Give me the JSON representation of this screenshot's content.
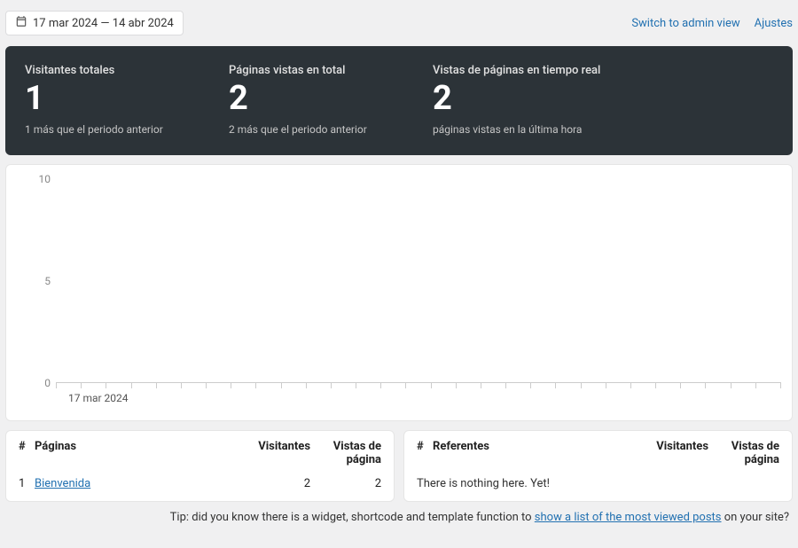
{
  "topbar": {
    "date_range": "17 mar 2024 — 14 abr 2024",
    "admin_link": "Switch to admin view",
    "settings_link": "Ajustes"
  },
  "stats": [
    {
      "label": "Visitantes totales",
      "value": "1",
      "sub": "1 más que el periodo anterior"
    },
    {
      "label": "Páginas vistas en total",
      "value": "2",
      "sub": "2 más que el periodo anterior"
    },
    {
      "label": "Vistas de páginas en tiempo real",
      "value": "2",
      "sub": "páginas vistas en la última hora"
    }
  ],
  "chart_data": {
    "type": "bar",
    "categories": [
      "17 mar 2024"
    ],
    "series": [
      {
        "name": "Visitantes",
        "values": [
          0
        ]
      },
      {
        "name": "Vistas de página",
        "values": [
          0
        ]
      }
    ],
    "title": "",
    "xlabel": "",
    "ylabel": "",
    "ylim": [
      0,
      10
    ],
    "yticks": [
      0,
      5,
      10
    ],
    "x_axis_label_visible": "17 mar 2024"
  },
  "pages_table": {
    "hash": "#",
    "name_header": "Páginas",
    "visitors_header": "Visitantes",
    "views_header": "Vistas de página",
    "rows": [
      {
        "index": "1",
        "name": "Bienvenida",
        "visitors": "2",
        "views": "2"
      }
    ]
  },
  "referrers_table": {
    "hash": "#",
    "name_header": "Referentes",
    "visitors_header": "Visitantes",
    "views_header": "Vistas de página",
    "empty": "There is nothing here. Yet!"
  },
  "tip": {
    "prefix": "Tip: did you know there is a widget, shortcode and template function to ",
    "link": "show a list of the most viewed posts",
    "suffix": " on your site?"
  }
}
